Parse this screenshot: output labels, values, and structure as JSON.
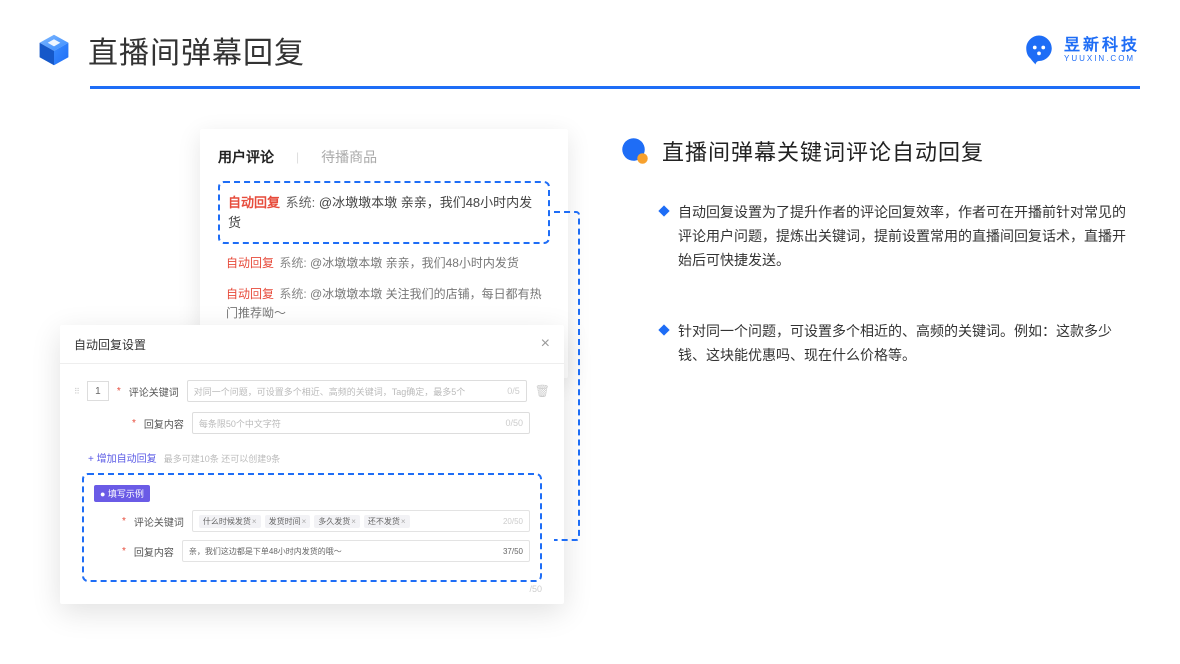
{
  "header": {
    "title": "直播间弹幕回复",
    "brand_name": "昱新科技",
    "brand_sub": "YUUXIN.COM"
  },
  "comments_panel": {
    "tab_active": "用户评论",
    "tab_inactive": "待播商品",
    "highlight_prefix": "自动回复",
    "highlight_sys": "系统:",
    "highlight_text": "@冰墩墩本墩 亲亲，我们48小时内发货",
    "item2_prefix": "自动回复",
    "item2_sys": "系统:",
    "item2_text": "@冰墩墩本墩 亲亲，我们48小时内发货",
    "item3_prefix": "自动回复",
    "item3_sys": "系统:",
    "item3_text": "@冰墩墩本墩 关注我们的店铺，每日都有热门推荐呦～"
  },
  "settings": {
    "title": "自动回复设置",
    "order": "1",
    "kw_label": "评论关键词",
    "kw_placeholder": "对同一个问题，可设置多个相近、高频的关键词，Tag确定，最多5个",
    "kw_count": "0/5",
    "content_label": "回复内容",
    "content_placeholder": "每条限50个中文字符",
    "content_count": "0/50",
    "add_link": "+ 增加自动回复",
    "add_tip": "最多可建10条 还可以创建9条",
    "example_badge": "● 填写示例",
    "ex_kw_label": "评论关键词",
    "ex_tags": [
      "什么时候发货",
      "发货时间",
      "多久发货",
      "还不发货"
    ],
    "ex_kw_count": "20/50",
    "ex_content_label": "回复内容",
    "ex_content_value": "亲，我们这边都是下单48小时内发货的哦～",
    "ex_content_count": "37/50",
    "outside_count": "/50"
  },
  "right": {
    "section_title": "直播间弹幕关键词评论自动回复",
    "bullet1": "自动回复设置为了提升作者的评论回复效率，作者可在开播前针对常见的评论用户问题，提炼出关键词，提前设置常用的直播间回复话术，直播开始后可快捷发送。",
    "bullet2": "针对同一个问题，可设置多个相近的、高频的关键词。例如：这款多少钱、这块能优惠吗、现在什么价格等。"
  }
}
